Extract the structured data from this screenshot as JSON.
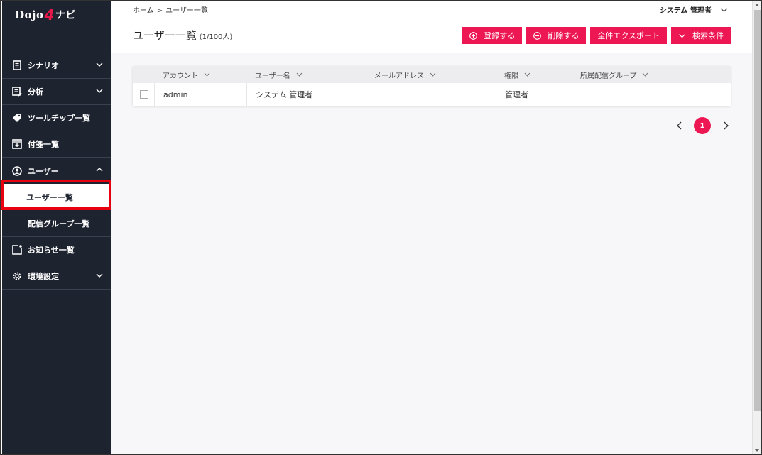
{
  "app": {
    "logo_left": "Dojo",
    "logo_four": "4",
    "logo_right": "ナビ"
  },
  "sidebar": {
    "items": [
      {
        "label": "シナリオ",
        "icon": "document-icon",
        "expandable": true
      },
      {
        "label": "分析",
        "icon": "analysis-icon",
        "expandable": true
      },
      {
        "label": "ツールチップ一覧",
        "icon": "tag-icon",
        "expandable": false
      },
      {
        "label": "付箋一覧",
        "icon": "sticky-note-icon",
        "expandable": false
      },
      {
        "label": "ユーザー",
        "icon": "user-circle-icon",
        "expandable": true,
        "expanded": true,
        "children": [
          {
            "label": "ユーザー一覧",
            "active": true
          },
          {
            "label": "配信グループ一覧",
            "active": false
          }
        ]
      },
      {
        "label": "お知らせ一覧",
        "icon": "notice-icon",
        "expandable": false
      },
      {
        "label": "環境設定",
        "icon": "gear-icon",
        "expandable": true
      }
    ]
  },
  "header": {
    "breadcrumb": [
      "ホーム",
      "ユーザー一覧"
    ],
    "breadcrumb_sep": ">",
    "user_name": "システム 管理者",
    "title": "ユーザー一覧",
    "count": "(1/100人)"
  },
  "actions": {
    "register": "登録する",
    "delete": "削除する",
    "export": "全件エクスポート",
    "search": "検索条件"
  },
  "table": {
    "columns": [
      "アカウント",
      "ユーザー名",
      "メールアドレス",
      "権限",
      "所属配信グループ"
    ],
    "rows": [
      [
        "admin",
        "システム 管理者",
        "",
        "管理者",
        ""
      ]
    ]
  },
  "pagination": {
    "current": "1"
  },
  "colors": {
    "accent": "#ec1753",
    "sidebar_bg": "#1e2330",
    "highlight": "#e80010"
  }
}
